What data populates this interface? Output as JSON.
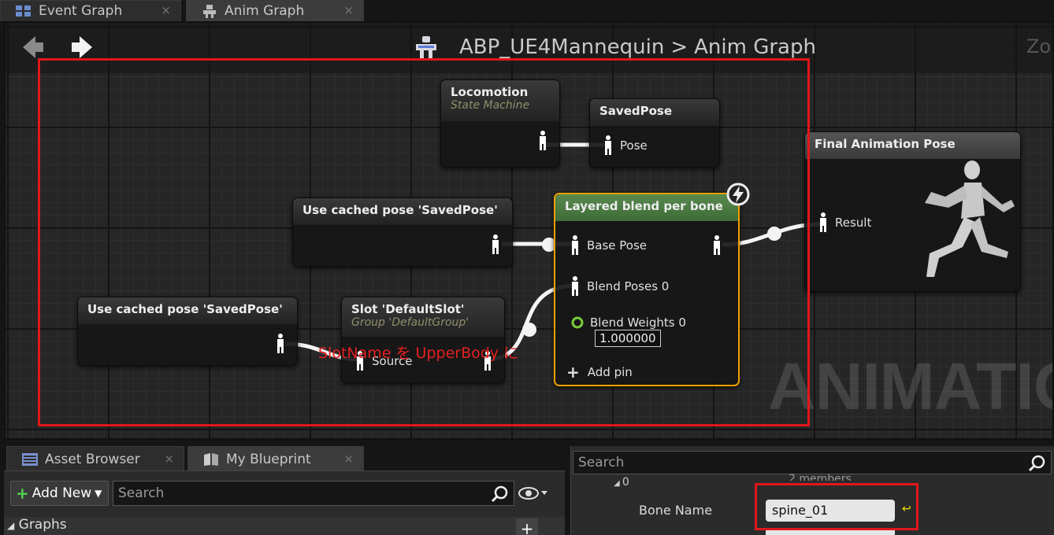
{
  "tabs": [
    {
      "label": "Event Graph",
      "close": "×"
    },
    {
      "label": "Anim Graph",
      "close": "×"
    }
  ],
  "breadcrumb": {
    "asset": "ABP_UE4Mannequin",
    "separator": ">",
    "graph": "Anim Graph"
  },
  "zoom_text": "Zo",
  "watermark": "ANIMATIO",
  "nodes": {
    "locomotion": {
      "title": "Locomotion",
      "subtitle": "State Machine"
    },
    "savedpose": {
      "title": "SavedPose",
      "pin": "Pose"
    },
    "final": {
      "title": "Final Animation Pose",
      "pin": "Result"
    },
    "cached1": {
      "title": "Use cached pose 'SavedPose'"
    },
    "cached2": {
      "title": "Use cached pose 'SavedPose'"
    },
    "slot": {
      "title": "Slot 'DefaultSlot'",
      "subtitle": "Group 'DefaultGroup'",
      "pin": "Source"
    },
    "layered": {
      "title": "Layered blend per bone",
      "base_pose": "Base Pose",
      "blend_poses": "Blend Poses 0",
      "blend_weights": "Blend Weights 0",
      "weight_value": "1.000000",
      "add_pin": "Add pin"
    }
  },
  "annotation": "SlotName を UpperBody に",
  "bottom_tabs": [
    {
      "label": "Asset Browser",
      "close": "×"
    },
    {
      "label": "My Blueprint",
      "close": "×"
    }
  ],
  "left_panel": {
    "add_new": "Add New",
    "search_placeholder": "Search",
    "graphs": "Graphs",
    "plus": "+"
  },
  "right_panel": {
    "search_placeholder": "Search",
    "row_index": "0",
    "members_text": "2 members",
    "bone_name_label": "Bone Name",
    "bone_name_value": "spine_01"
  },
  "colors": {
    "accent_red": "#e0171b",
    "selection": "#f0a000",
    "green_head": "#4d7a45"
  }
}
